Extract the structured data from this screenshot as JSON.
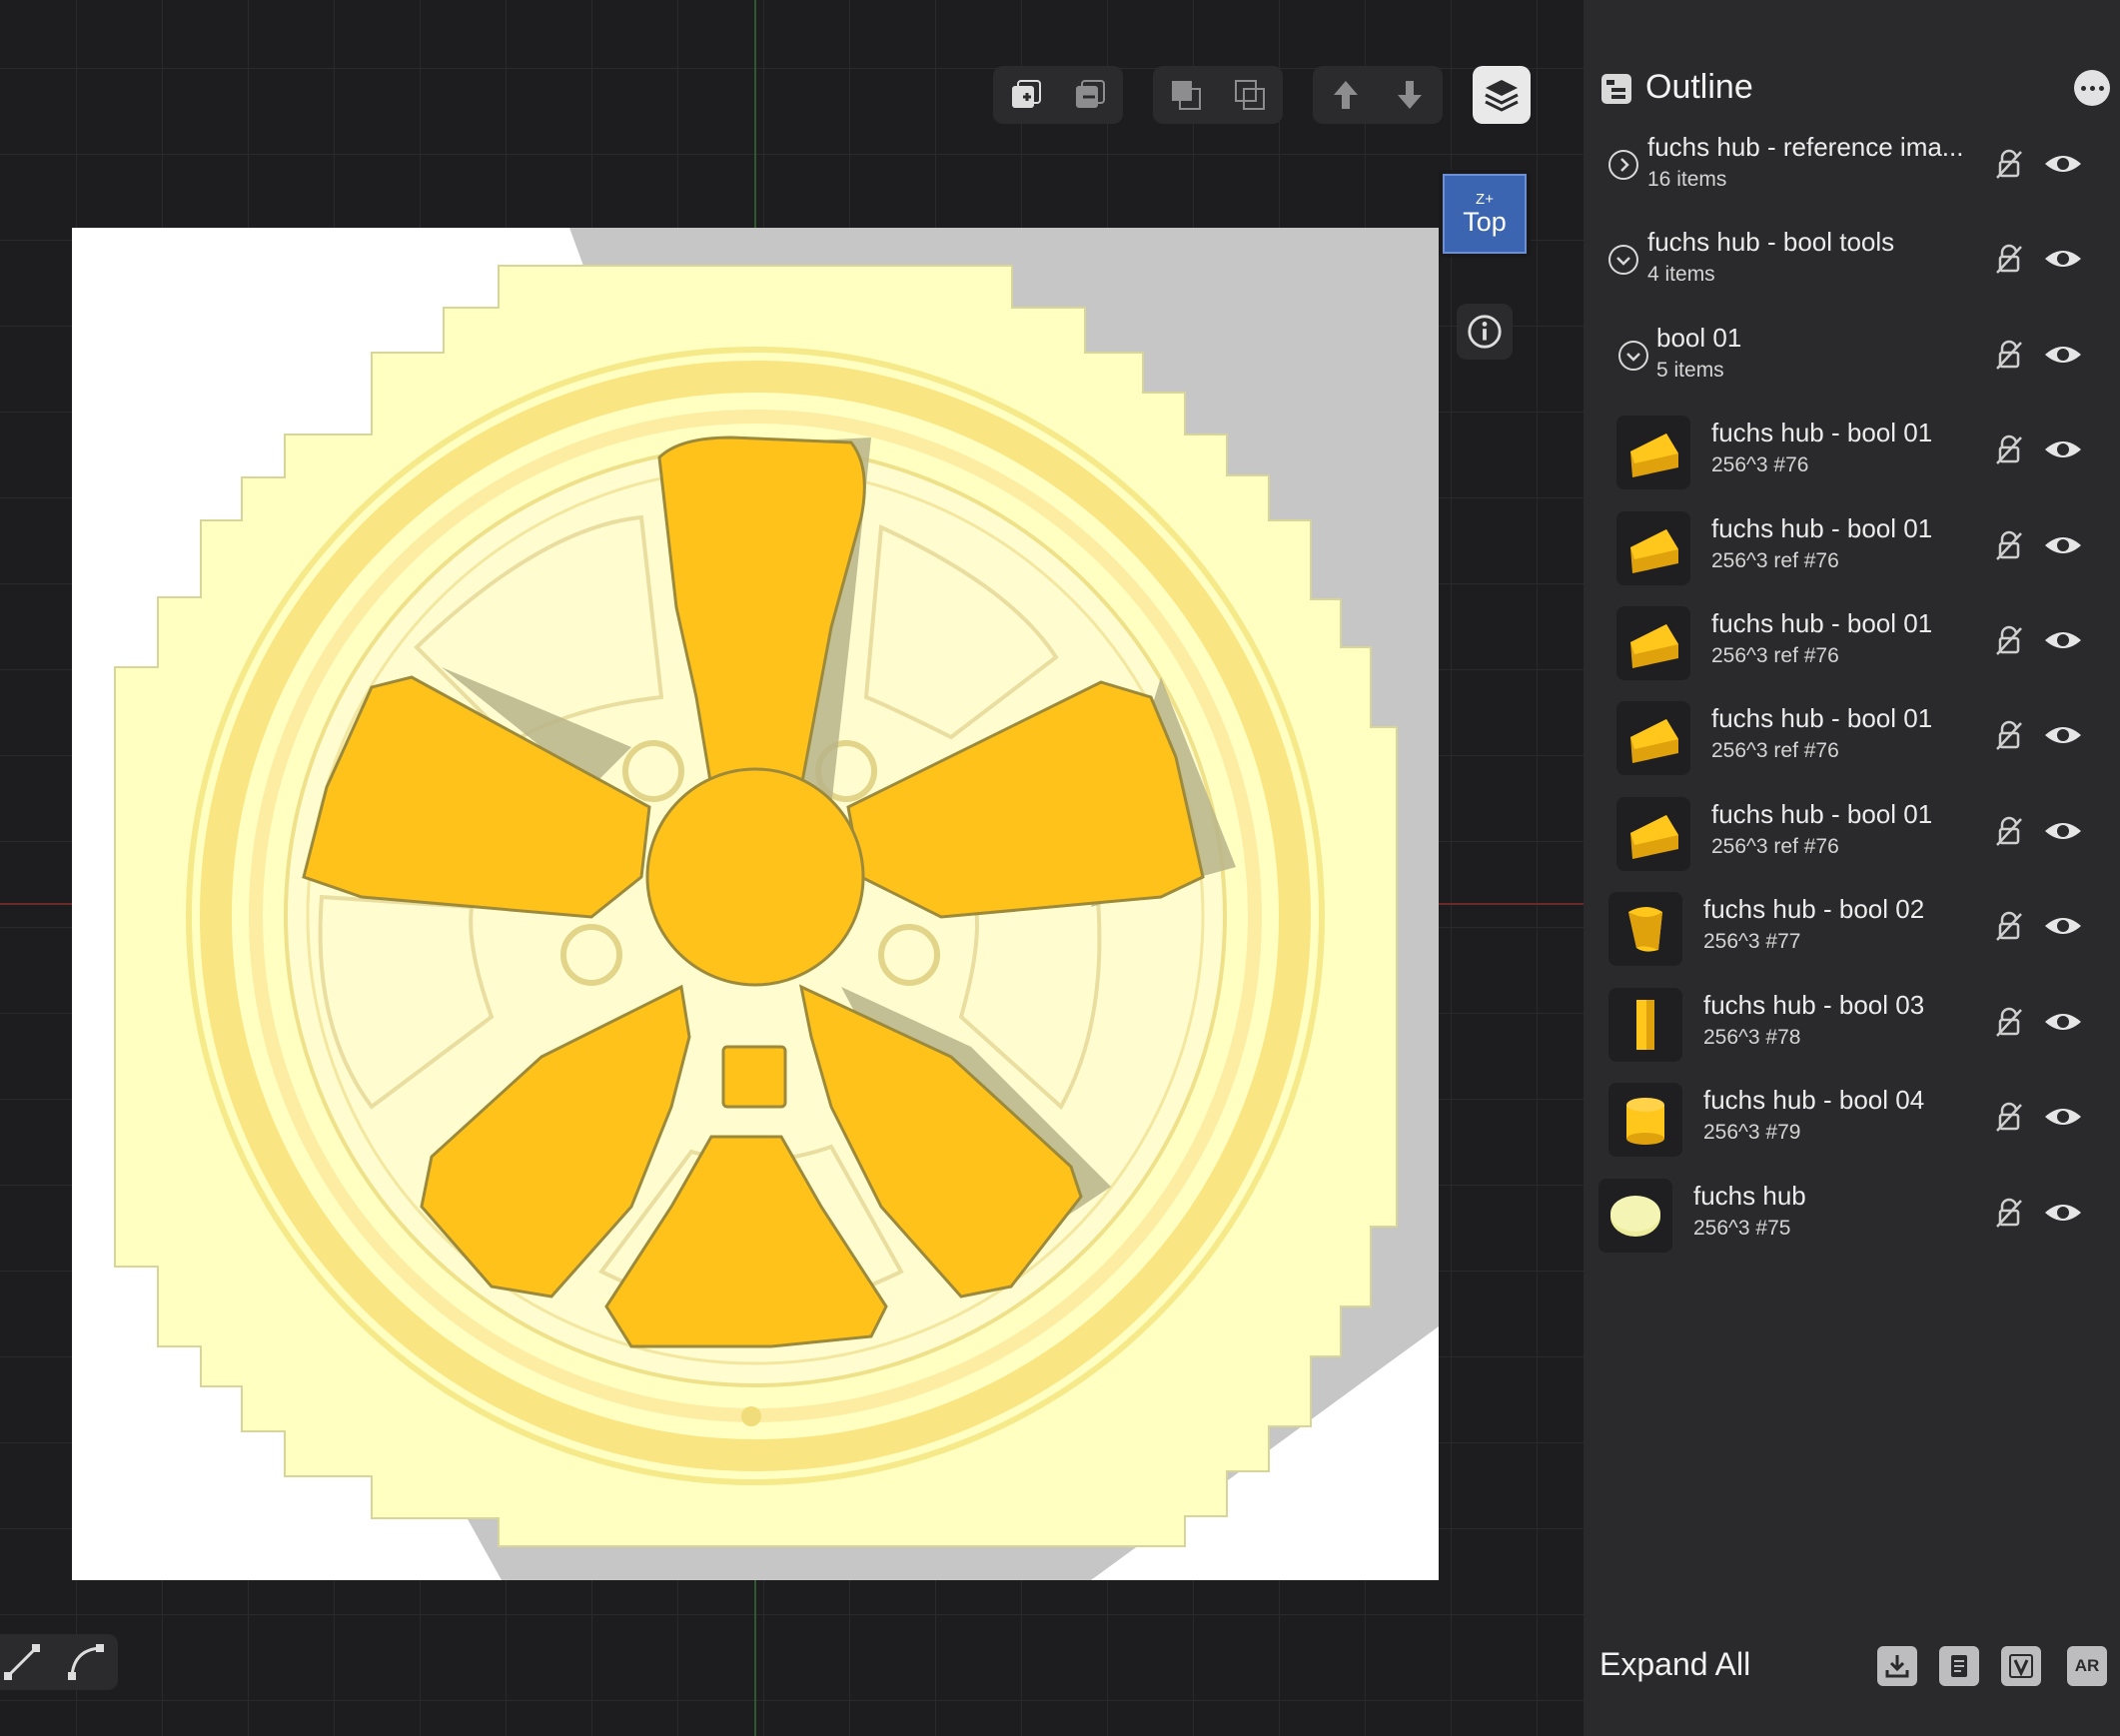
{
  "viewport": {
    "view_cube": {
      "axis": "Z+",
      "label": "Top"
    },
    "toolbar": {
      "icons": [
        "add-layer-icon",
        "remove-layer-icon",
        "merge-icon",
        "subtract-icon",
        "move-up-icon",
        "move-down-icon",
        "layers-icon"
      ]
    },
    "colors": {
      "hub": "#ffffc2",
      "spokes": "#ffc21a",
      "background": "#1d1d1f"
    }
  },
  "outline": {
    "title": "Outline",
    "items": [
      {
        "name": "fuchs hub - reference ima...",
        "sub": "16 items",
        "kind": "group-collapsed",
        "icon": "chevron-right-icon"
      },
      {
        "name": "fuchs hub - bool tools",
        "sub": "4 items",
        "kind": "group-expanded",
        "icon": "chevron-down-icon"
      },
      {
        "name": "bool 01",
        "sub": "5 items",
        "kind": "group-expanded",
        "icon": "chevron-down-icon"
      },
      {
        "name": "fuchs hub - bool 01",
        "sub": "256^3 #76",
        "kind": "wedge"
      },
      {
        "name": "fuchs hub - bool 01",
        "sub": "256^3 ref #76",
        "kind": "wedge"
      },
      {
        "name": "fuchs hub - bool 01",
        "sub": "256^3 ref #76",
        "kind": "wedge"
      },
      {
        "name": "fuchs hub - bool 01",
        "sub": "256^3 ref #76",
        "kind": "wedge"
      },
      {
        "name": "fuchs hub - bool 01",
        "sub": "256^3 ref #76",
        "kind": "wedge"
      },
      {
        "name": "fuchs hub - bool 02",
        "sub": "256^3 #77",
        "kind": "segment"
      },
      {
        "name": "fuchs hub - bool 03",
        "sub": "256^3 #78",
        "kind": "bar"
      },
      {
        "name": "fuchs hub - bool 04",
        "sub": "256^3 #79",
        "kind": "cylinder"
      },
      {
        "name": "fuchs hub",
        "sub": "256^3 #75",
        "kind": "disc"
      }
    ],
    "footer": {
      "expand_all": "Expand All",
      "buttons": [
        "download-icon",
        "document-icon",
        "v-icon",
        "ar-icon"
      ],
      "ar_label": "AR"
    }
  }
}
